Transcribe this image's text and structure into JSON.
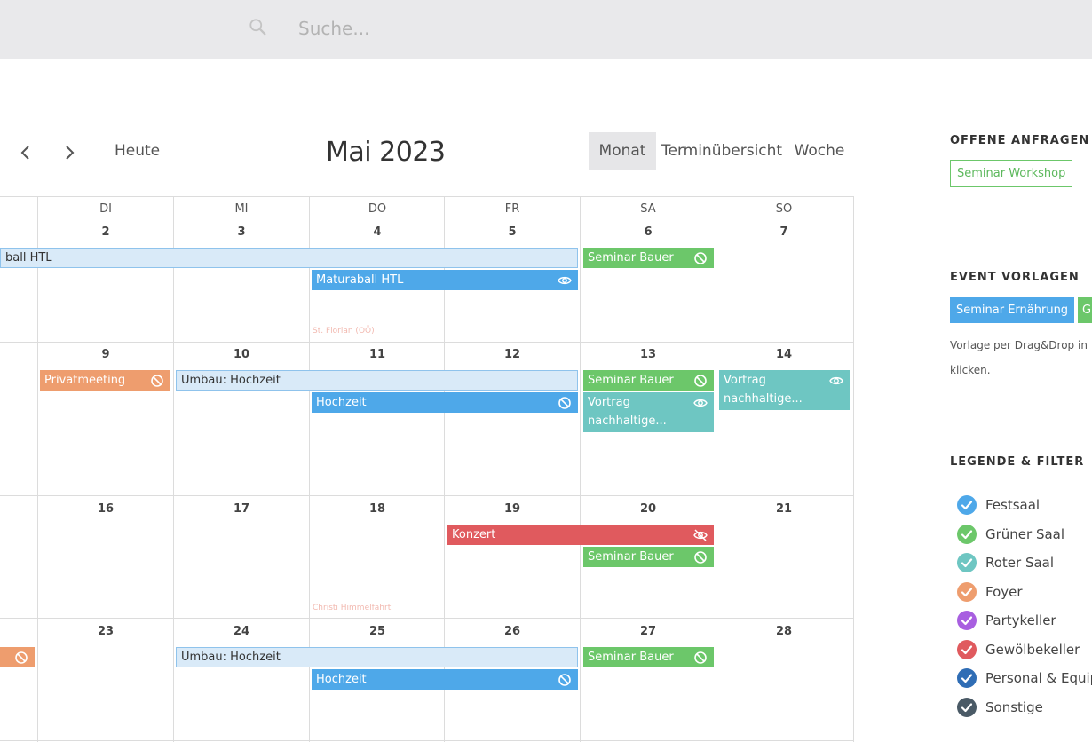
{
  "search": {
    "placeholder": "Suche..."
  },
  "toolbar": {
    "today_label": "Heute",
    "month_title": "Mai 2023",
    "views": [
      "Monat",
      "Terminübersicht",
      "Woche"
    ]
  },
  "calendar": {
    "weekdays": [
      "DI",
      "MI",
      "DO",
      "FR",
      "SA",
      "SO"
    ],
    "weeks": [
      {
        "days": [
          "2",
          "3",
          "4",
          "5",
          "6",
          "7"
        ]
      },
      {
        "days": [
          "9",
          "10",
          "11",
          "12",
          "13",
          "14"
        ]
      },
      {
        "days": [
          "16",
          "17",
          "18",
          "19",
          "20",
          "21"
        ]
      },
      {
        "days": [
          "23",
          "24",
          "25",
          "26",
          "27",
          "28"
        ]
      }
    ],
    "holidays": [
      "St. Florian (OÖ)",
      "Christi Himmelfahrt"
    ],
    "events": [
      {
        "title": "ball HTL"
      },
      {
        "title": "Seminar Bauer"
      },
      {
        "title": "Maturaball HTL"
      },
      {
        "title": "Privatmeeting"
      },
      {
        "title": "Umbau: Hochzeit"
      },
      {
        "title": "Seminar Bauer"
      },
      {
        "title": "Vortrag nachhaltige..."
      },
      {
        "title": "Hochzeit"
      },
      {
        "title": "Vortrag nachhaltige..."
      },
      {
        "title": "Konzert"
      },
      {
        "title": "Seminar Bauer"
      },
      {
        "title": "Umbau: Hochzeit"
      },
      {
        "title": "Seminar Bauer"
      },
      {
        "title": "Hochzeit"
      }
    ]
  },
  "sidebar": {
    "open_requests_heading": "OFFENE ANFRAGEN",
    "open_requests": [
      "Seminar Workshop"
    ],
    "templates_heading": "EVENT VORLAGEN",
    "templates": [
      "Seminar Ernährung",
      "G"
    ],
    "templates_hint_line1": "Vorlage per Drag&Drop in",
    "templates_hint_line2": "klicken.",
    "legend_heading": "LEGENDE & FILTER",
    "legend": [
      {
        "label": "Festsaal",
        "color": "#4ea8e9"
      },
      {
        "label": "Grüner Saal",
        "color": "#6cc76a"
      },
      {
        "label": "Roter Saal",
        "color": "#6ec6c2"
      },
      {
        "label": "Foyer",
        "color": "#ee9d6e"
      },
      {
        "label": "Partykeller",
        "color": "#a85fe0"
      },
      {
        "label": "Gewölbekeller",
        "color": "#e05a5e"
      },
      {
        "label": "Personal & Equip",
        "color": "#2f6db5"
      },
      {
        "label": "Sonstige",
        "color": "#4a5a66"
      }
    ]
  }
}
